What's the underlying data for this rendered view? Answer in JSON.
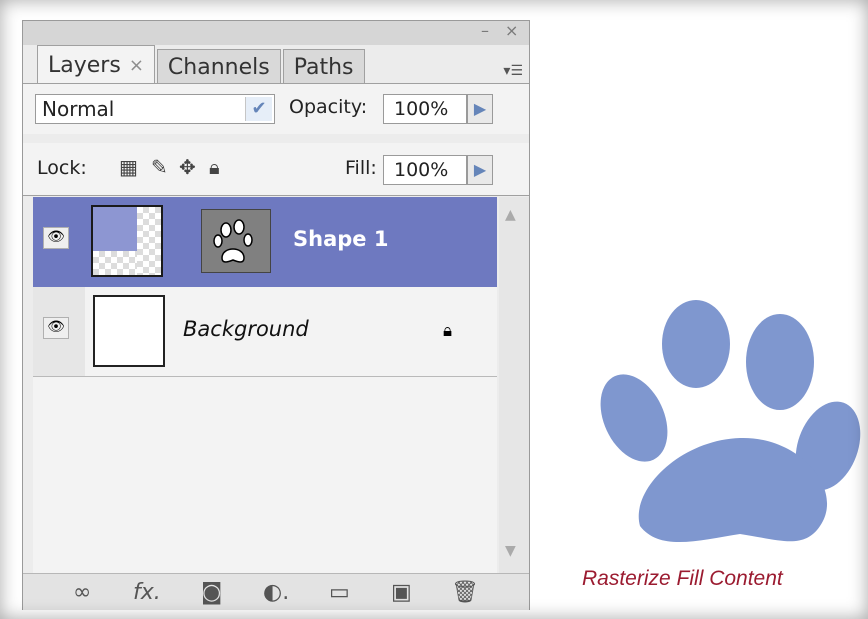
{
  "tabs": [
    {
      "label": "Layers",
      "close": "×"
    },
    {
      "label": "Channels"
    },
    {
      "label": "Paths"
    }
  ],
  "blend_mode": {
    "value": "Normal"
  },
  "opacity": {
    "label": "Opacity:",
    "value": "100%"
  },
  "lock": {
    "label": "Lock:"
  },
  "fill": {
    "label": "Fill:",
    "value": "100%"
  },
  "layers": [
    {
      "name": "Shape 1",
      "selected": true
    },
    {
      "name": "Background",
      "locked": true
    }
  ],
  "caption": "Rasterize Fill Content",
  "colors": {
    "selection": "#6e79c0",
    "paw": "#7f97cf",
    "caption": "#9b1b30"
  }
}
